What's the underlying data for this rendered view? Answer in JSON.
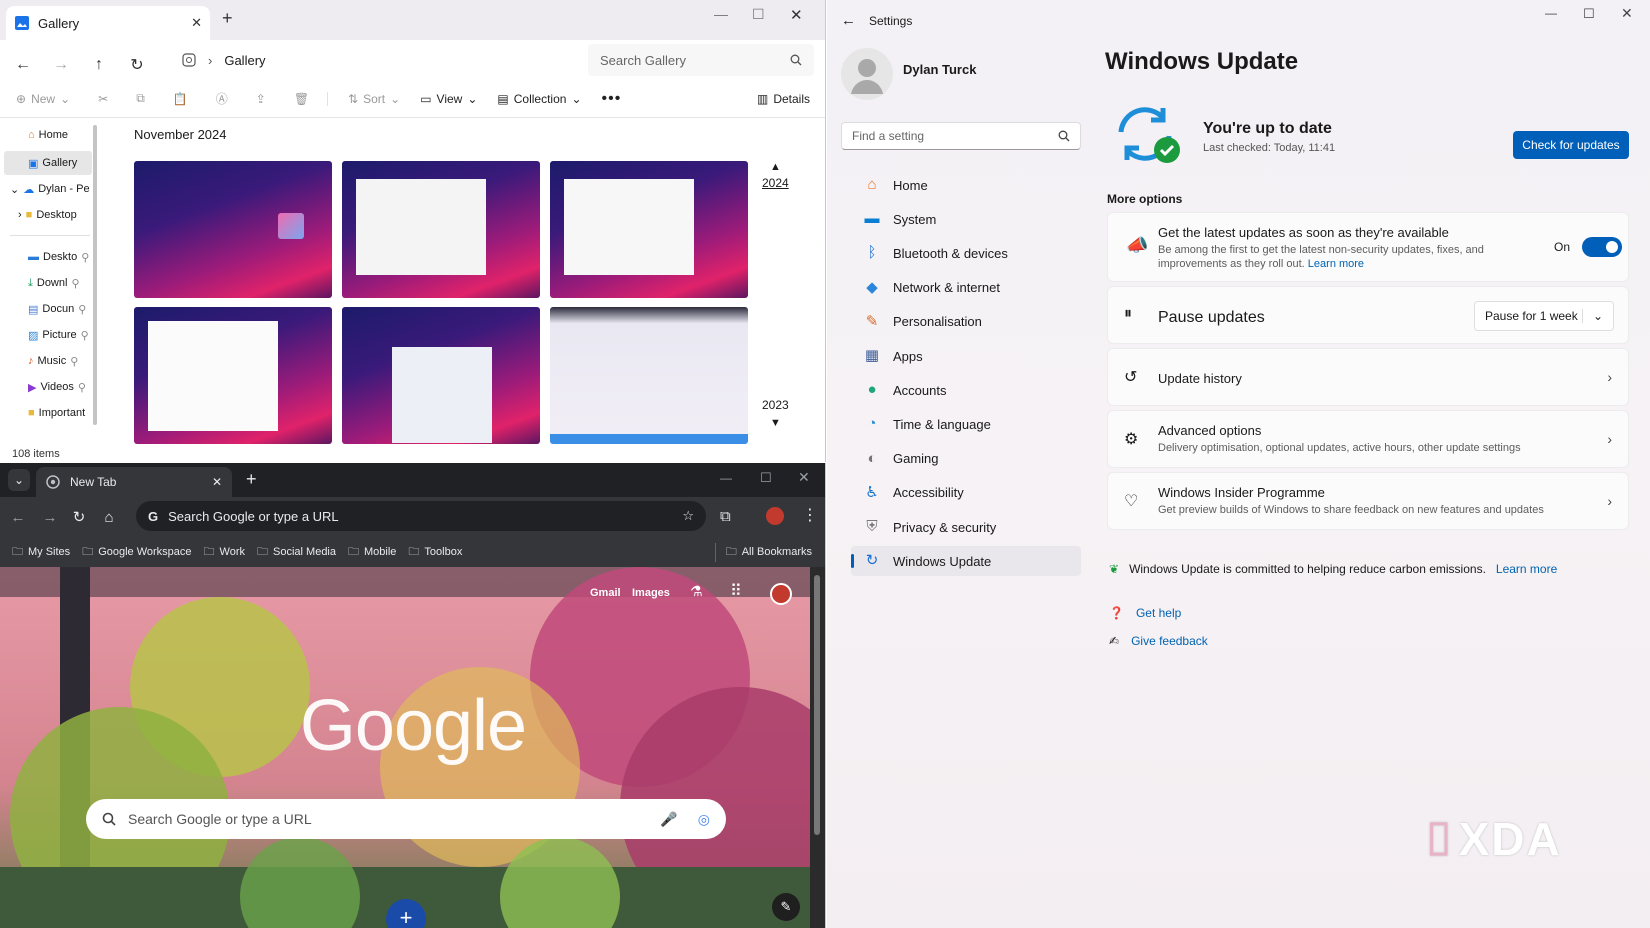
{
  "explorer": {
    "tab_title": "Gallery",
    "address": "Gallery",
    "search_placeholder": "Search Gallery",
    "commands": {
      "new": "New",
      "sort": "Sort",
      "view": "View",
      "collection": "Collection",
      "details": "Details"
    },
    "sidebar": [
      {
        "label": "Home"
      },
      {
        "label": "Gallery"
      },
      {
        "label": "Dylan - Pe"
      },
      {
        "label": "Desktop"
      },
      {
        "label": "Deskto"
      },
      {
        "label": "Downl"
      },
      {
        "label": "Docun"
      },
      {
        "label": "Picture"
      },
      {
        "label": "Music"
      },
      {
        "label": "Videos"
      },
      {
        "label": "Important"
      }
    ],
    "group_title": "November 2024",
    "timeline": {
      "top": "2024",
      "bottom": "2023"
    },
    "status": "108 items"
  },
  "chrome": {
    "tab_title": "New Tab",
    "omnibox_placeholder": "Search Google or type a URL",
    "bookmarks": [
      "My Sites",
      "Google Workspace",
      "Work",
      "Social Media",
      "Mobile",
      "Toolbox"
    ],
    "all_bookmarks": "All Bookmarks",
    "links": {
      "gmail": "Gmail",
      "images": "Images"
    },
    "logo_text": "Google",
    "ntp_search_placeholder": "Search Google or type a URL"
  },
  "settings": {
    "window_title": "Settings",
    "user_name": "Dylan Turck",
    "search_placeholder": "Find a setting",
    "nav": [
      {
        "label": "Home",
        "color": "#e07a2e"
      },
      {
        "label": "System",
        "color": "#0a7fd2"
      },
      {
        "label": "Bluetooth & devices",
        "color": "#1e6fd9"
      },
      {
        "label": "Network & internet",
        "color": "#2a86db"
      },
      {
        "label": "Personalisation",
        "color": "#d96a2b"
      },
      {
        "label": "Apps",
        "color": "#3f5f9a"
      },
      {
        "label": "Accounts",
        "color": "#1fa67a"
      },
      {
        "label": "Time & language",
        "color": "#2a8fd8"
      },
      {
        "label": "Gaming",
        "color": "#767676"
      },
      {
        "label": "Accessibility",
        "color": "#1a73c9"
      },
      {
        "label": "Privacy & security",
        "color": "#7a7a7a"
      },
      {
        "label": "Windows Update",
        "color": "#1a6fd6"
      }
    ],
    "page_title": "Windows Update",
    "status_title": "You're up to date",
    "status_sub": "Last checked: Today, 11:41",
    "check_button": "Check for updates",
    "more_options": "More options",
    "options": {
      "latest": {
        "title": "Get the latest updates as soon as they're available",
        "desc": "Be among the first to get the latest non-security updates, fixes, and improvements as they roll out.",
        "link": "Learn more",
        "toggle_label": "On",
        "toggle_on": true
      },
      "pause": {
        "title": "Pause updates",
        "select": "Pause for 1 week"
      },
      "history": {
        "title": "Update history"
      },
      "advanced": {
        "title": "Advanced options",
        "desc": "Delivery optimisation, optional updates, active hours, other update settings"
      },
      "insider": {
        "title": "Windows Insider Programme",
        "desc": "Get preview builds of Windows to share feedback on new features and updates"
      }
    },
    "carbon_text": "Windows Update is committed to helping reduce carbon emissions.",
    "carbon_link": "Learn more",
    "help": "Get help",
    "feedback": "Give feedback",
    "accent": "#005fb8"
  },
  "watermark": "XDA"
}
